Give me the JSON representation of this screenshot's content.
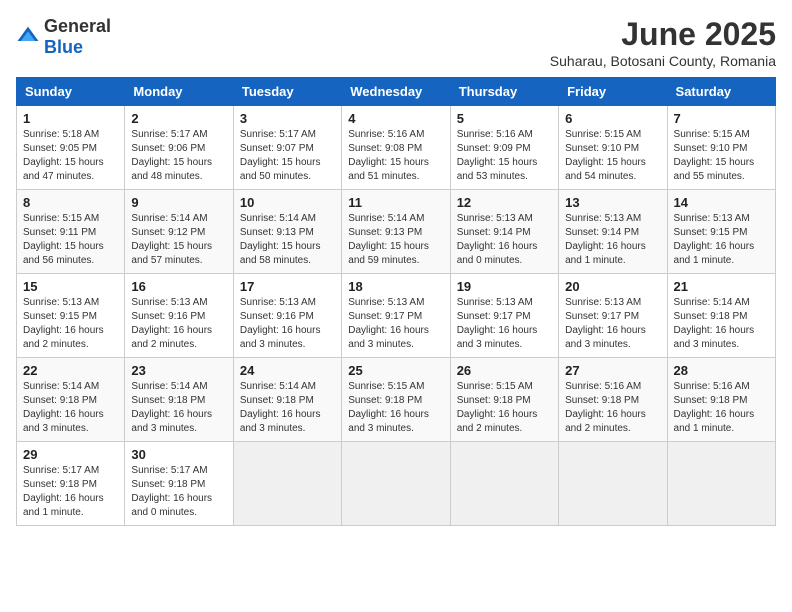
{
  "logo": {
    "general": "General",
    "blue": "Blue"
  },
  "header": {
    "month": "June 2025",
    "location": "Suharau, Botosani County, Romania"
  },
  "weekdays": [
    "Sunday",
    "Monday",
    "Tuesday",
    "Wednesday",
    "Thursday",
    "Friday",
    "Saturday"
  ],
  "weeks": [
    [
      {
        "day": "1",
        "info": "Sunrise: 5:18 AM\nSunset: 9:05 PM\nDaylight: 15 hours\nand 47 minutes."
      },
      {
        "day": "2",
        "info": "Sunrise: 5:17 AM\nSunset: 9:06 PM\nDaylight: 15 hours\nand 48 minutes."
      },
      {
        "day": "3",
        "info": "Sunrise: 5:17 AM\nSunset: 9:07 PM\nDaylight: 15 hours\nand 50 minutes."
      },
      {
        "day": "4",
        "info": "Sunrise: 5:16 AM\nSunset: 9:08 PM\nDaylight: 15 hours\nand 51 minutes."
      },
      {
        "day": "5",
        "info": "Sunrise: 5:16 AM\nSunset: 9:09 PM\nDaylight: 15 hours\nand 53 minutes."
      },
      {
        "day": "6",
        "info": "Sunrise: 5:15 AM\nSunset: 9:10 PM\nDaylight: 15 hours\nand 54 minutes."
      },
      {
        "day": "7",
        "info": "Sunrise: 5:15 AM\nSunset: 9:10 PM\nDaylight: 15 hours\nand 55 minutes."
      }
    ],
    [
      {
        "day": "8",
        "info": "Sunrise: 5:15 AM\nSunset: 9:11 PM\nDaylight: 15 hours\nand 56 minutes."
      },
      {
        "day": "9",
        "info": "Sunrise: 5:14 AM\nSunset: 9:12 PM\nDaylight: 15 hours\nand 57 minutes."
      },
      {
        "day": "10",
        "info": "Sunrise: 5:14 AM\nSunset: 9:13 PM\nDaylight: 15 hours\nand 58 minutes."
      },
      {
        "day": "11",
        "info": "Sunrise: 5:14 AM\nSunset: 9:13 PM\nDaylight: 15 hours\nand 59 minutes."
      },
      {
        "day": "12",
        "info": "Sunrise: 5:13 AM\nSunset: 9:14 PM\nDaylight: 16 hours\nand 0 minutes."
      },
      {
        "day": "13",
        "info": "Sunrise: 5:13 AM\nSunset: 9:14 PM\nDaylight: 16 hours\nand 1 minute."
      },
      {
        "day": "14",
        "info": "Sunrise: 5:13 AM\nSunset: 9:15 PM\nDaylight: 16 hours\nand 1 minute."
      }
    ],
    [
      {
        "day": "15",
        "info": "Sunrise: 5:13 AM\nSunset: 9:15 PM\nDaylight: 16 hours\nand 2 minutes."
      },
      {
        "day": "16",
        "info": "Sunrise: 5:13 AM\nSunset: 9:16 PM\nDaylight: 16 hours\nand 2 minutes."
      },
      {
        "day": "17",
        "info": "Sunrise: 5:13 AM\nSunset: 9:16 PM\nDaylight: 16 hours\nand 3 minutes."
      },
      {
        "day": "18",
        "info": "Sunrise: 5:13 AM\nSunset: 9:17 PM\nDaylight: 16 hours\nand 3 minutes."
      },
      {
        "day": "19",
        "info": "Sunrise: 5:13 AM\nSunset: 9:17 PM\nDaylight: 16 hours\nand 3 minutes."
      },
      {
        "day": "20",
        "info": "Sunrise: 5:13 AM\nSunset: 9:17 PM\nDaylight: 16 hours\nand 3 minutes."
      },
      {
        "day": "21",
        "info": "Sunrise: 5:14 AM\nSunset: 9:18 PM\nDaylight: 16 hours\nand 3 minutes."
      }
    ],
    [
      {
        "day": "22",
        "info": "Sunrise: 5:14 AM\nSunset: 9:18 PM\nDaylight: 16 hours\nand 3 minutes."
      },
      {
        "day": "23",
        "info": "Sunrise: 5:14 AM\nSunset: 9:18 PM\nDaylight: 16 hours\nand 3 minutes."
      },
      {
        "day": "24",
        "info": "Sunrise: 5:14 AM\nSunset: 9:18 PM\nDaylight: 16 hours\nand 3 minutes."
      },
      {
        "day": "25",
        "info": "Sunrise: 5:15 AM\nSunset: 9:18 PM\nDaylight: 16 hours\nand 3 minutes."
      },
      {
        "day": "26",
        "info": "Sunrise: 5:15 AM\nSunset: 9:18 PM\nDaylight: 16 hours\nand 2 minutes."
      },
      {
        "day": "27",
        "info": "Sunrise: 5:16 AM\nSunset: 9:18 PM\nDaylight: 16 hours\nand 2 minutes."
      },
      {
        "day": "28",
        "info": "Sunrise: 5:16 AM\nSunset: 9:18 PM\nDaylight: 16 hours\nand 1 minute."
      }
    ],
    [
      {
        "day": "29",
        "info": "Sunrise: 5:17 AM\nSunset: 9:18 PM\nDaylight: 16 hours\nand 1 minute."
      },
      {
        "day": "30",
        "info": "Sunrise: 5:17 AM\nSunset: 9:18 PM\nDaylight: 16 hours\nand 0 minutes."
      },
      {
        "day": "",
        "info": ""
      },
      {
        "day": "",
        "info": ""
      },
      {
        "day": "",
        "info": ""
      },
      {
        "day": "",
        "info": ""
      },
      {
        "day": "",
        "info": ""
      }
    ]
  ]
}
